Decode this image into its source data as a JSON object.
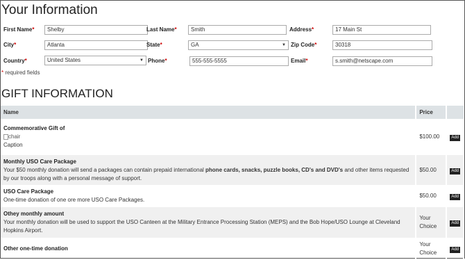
{
  "your_info": {
    "heading": "Your Information",
    "first_name": {
      "label": "First Name",
      "value": "Shelby"
    },
    "last_name": {
      "label": "Last Name",
      "value": "Smith"
    },
    "address": {
      "label": "Address",
      "value": "17 Main St"
    },
    "city": {
      "label": "City",
      "value": "Atlanta"
    },
    "state": {
      "label": "State",
      "value": "GA"
    },
    "zip": {
      "label": "Zip Code",
      "value": "30318"
    },
    "country": {
      "label": "Country",
      "value": "United States"
    },
    "phone": {
      "label": "Phone",
      "value": "555-555-5555"
    },
    "email": {
      "label": "Email",
      "value": "s.smith@netscape.com"
    },
    "required_mark": "*",
    "required_note": "required fields"
  },
  "gift_info": {
    "heading": "GIFT INFORMATION",
    "col_name": "Name",
    "col_price": "Price",
    "add_label": "Add",
    "items": [
      {
        "title": "Commemorative Gift of",
        "image_alt": "chair",
        "caption": "Caption",
        "price": "$100.00"
      },
      {
        "title": "Monthly USO Care Package",
        "desc_pre": "Your $50 monthly donation will send a packages can contain prepaid international ",
        "desc_bold": "phone cards, snacks, puzzle books, CD's and DVD's",
        "desc_post": " and other items requested by our troops along with a personal message of support.",
        "price": "$50.00"
      },
      {
        "title": "USO Care Package",
        "desc": "One-time donation of one ore more USO Care Packages.",
        "price": "$50.00"
      },
      {
        "title": "Othey monthly amount",
        "desc": "Your monthly donation will be used to support the USO Canteen at the Military Entrance Processing Station (MEPS) and the Bob Hope/USO Lounge at Cleveland Hopkins Airport.",
        "price": "Your Choice"
      },
      {
        "title": "Other one-time donation",
        "price": "Your Choice"
      }
    ]
  }
}
